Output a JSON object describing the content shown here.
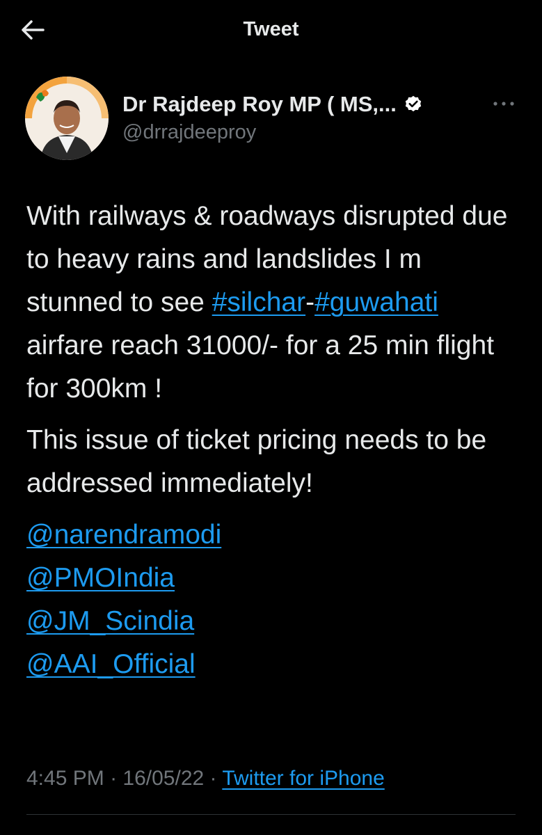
{
  "header": {
    "title": "Tweet",
    "back_icon": "arrow-left-icon"
  },
  "author": {
    "name": "Dr Rajdeep Roy MP ( MS,...",
    "handle": "@drrajdeeproy",
    "verified_icon": "verified-badge-icon",
    "more_icon": "more-horizontal-icon"
  },
  "tweet": {
    "line1_prefix": "With railways & roadways disrupted due to heavy rains and landslides I m stunned to see ",
    "hashtag1": "#silchar",
    "separator": "-",
    "hashtag2": "#guwahati",
    "line1_suffix": " airfare reach 31000/- for a 25 min flight for 300km !",
    "paragraph2": "This issue of ticket pricing needs to be addressed immediately!",
    "mentions": [
      "@narendramodi",
      "@PMOIndia",
      "@JM_Scindia",
      "@AAI_Official"
    ]
  },
  "meta": {
    "time": "4:45 PM",
    "dot1": " · ",
    "date": "16/05/22",
    "dot2": " · ",
    "source": "Twitter for iPhone"
  },
  "colors": {
    "background": "#000000",
    "text": "#e7e9ea",
    "secondary": "#71767b",
    "link": "#1d9bf0",
    "divider": "#2f3336"
  }
}
